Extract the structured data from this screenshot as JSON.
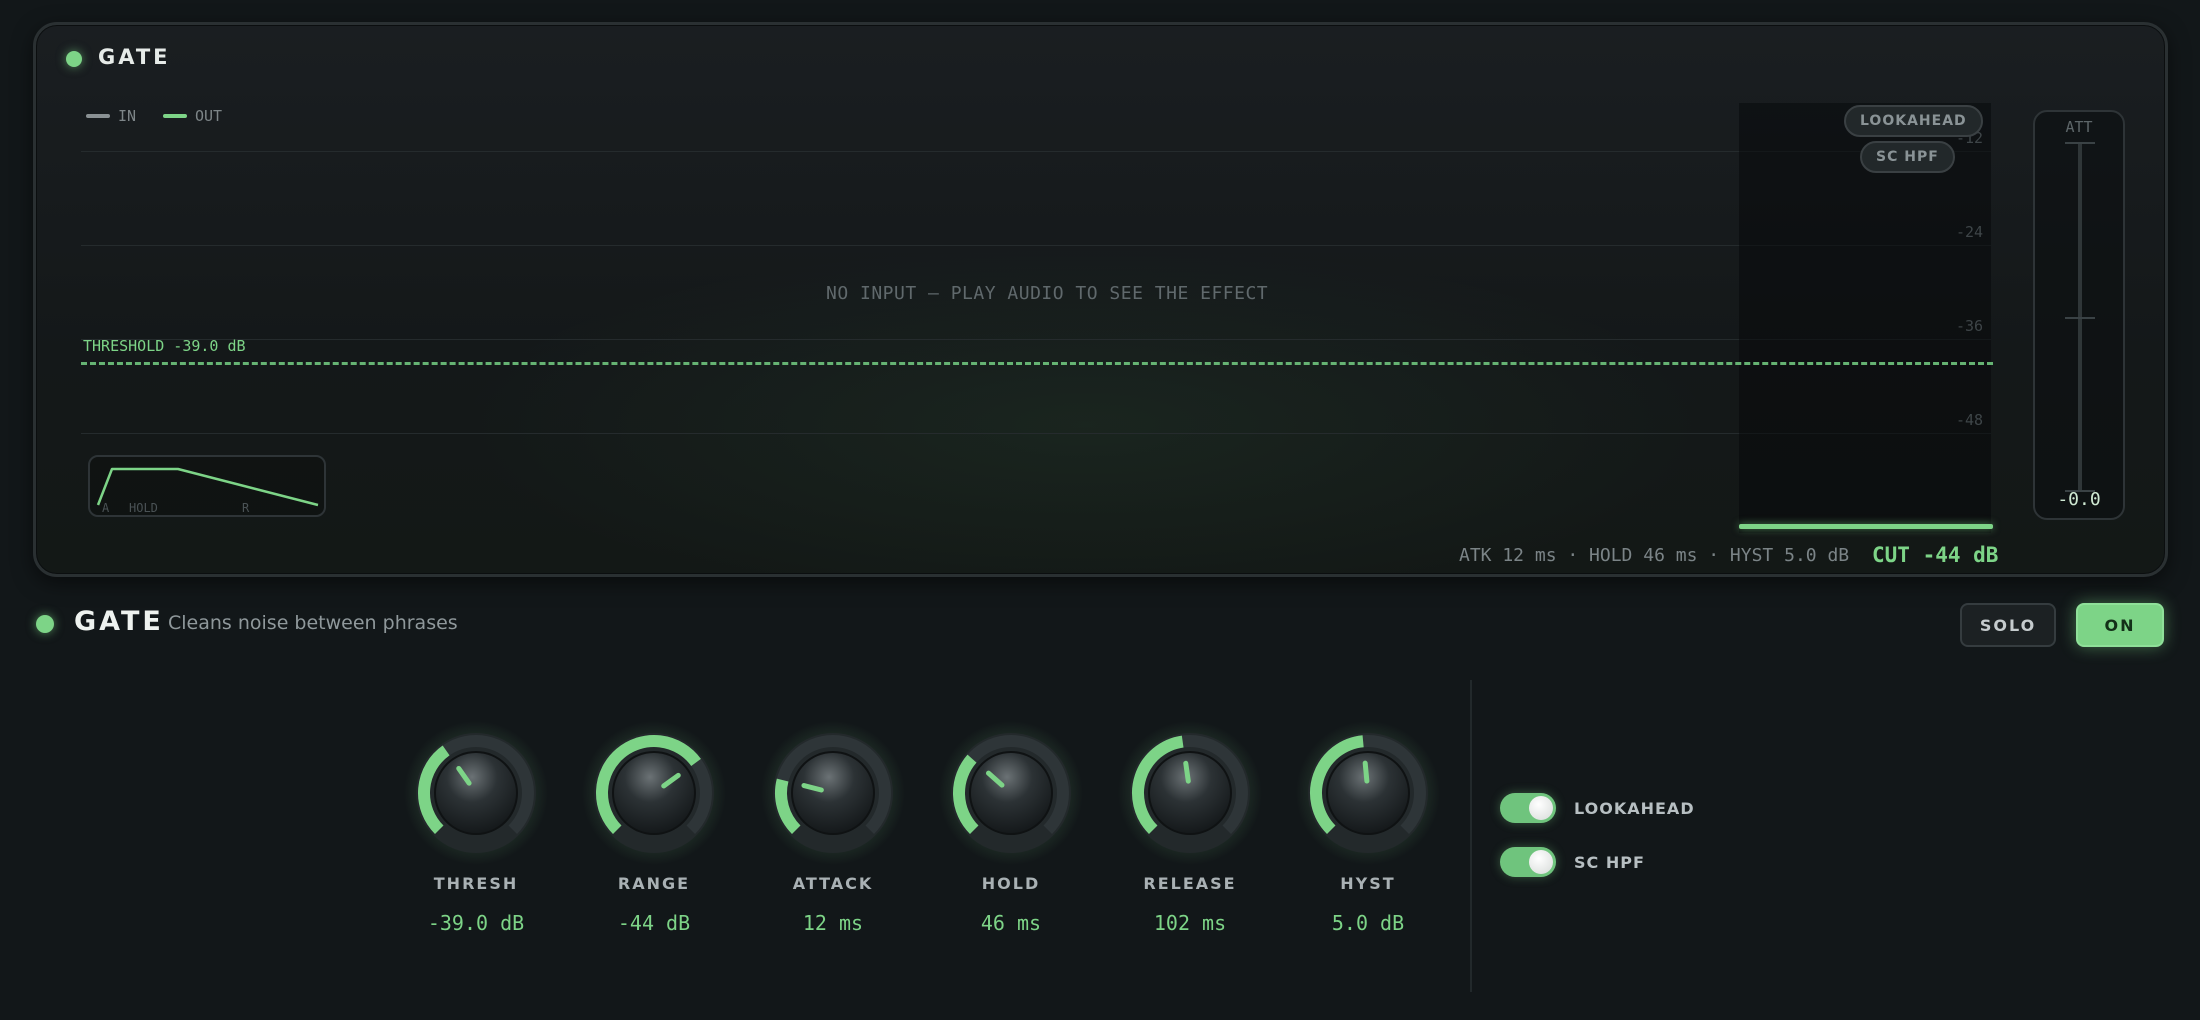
{
  "display": {
    "title": "GATE",
    "legend": [
      {
        "label": "IN",
        "color": "#8a9194"
      },
      {
        "label": "OUT",
        "color": "#7dd487"
      }
    ],
    "scale_labels": [
      "-12",
      "-24",
      "-36",
      "-48"
    ],
    "pills": [
      "LOOKAHEAD",
      "SC HPF"
    ],
    "empty_message": "NO INPUT — PLAY AUDIO TO SEE THE EFFECT",
    "threshold_label": "THRESHOLD -39.0 dB",
    "envelope_labels": {
      "attack": "A",
      "hold": "HOLD",
      "release": "R"
    },
    "params_readout": "ATK 12 ms · HOLD 46 ms · HYST 5.0 dB",
    "cut_readout": "CUT -44 dB",
    "att_meter": {
      "label": "ATT",
      "value": "-0.0"
    }
  },
  "header": {
    "title": "GATE",
    "subtitle": "Cleans noise between phrases",
    "solo_label": "SOLO",
    "on_label": "ON"
  },
  "knobs": [
    {
      "id": "thresh",
      "label": "THRESH",
      "value": "-39.0 dB",
      "fraction": 0.37
    },
    {
      "id": "range",
      "label": "RANGE",
      "value": "-44 dB",
      "fraction": 0.7
    },
    {
      "id": "attack",
      "label": "ATTACK",
      "value": "12 ms",
      "fraction": 0.22
    },
    {
      "id": "hold",
      "label": "HOLD",
      "value": "46 ms",
      "fraction": 0.32
    },
    {
      "id": "release",
      "label": "RELEASE",
      "value": "102 ms",
      "fraction": 0.47
    },
    {
      "id": "hyst",
      "label": "HYST",
      "value": "5.0 dB",
      "fraction": 0.48
    }
  ],
  "toggles": [
    {
      "label": "LOOKAHEAD",
      "on": true
    },
    {
      "label": "SC HPF",
      "on": true
    }
  ],
  "colors": {
    "accent": "#7dd487",
    "background": "#121719"
  }
}
